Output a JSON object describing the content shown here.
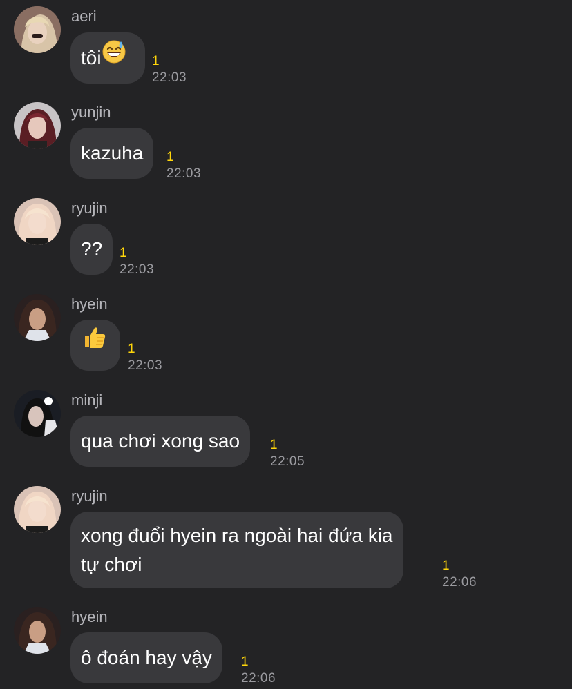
{
  "messages": [
    {
      "sender": "aeri",
      "text": "tôi",
      "emoji": "grinning-sweat-emoji",
      "unread": "1",
      "time": "22:03"
    },
    {
      "sender": "yunjin",
      "text": "kazuha",
      "unread": "1",
      "time": "22:03"
    },
    {
      "sender": "ryujin",
      "text": "??",
      "unread": "1",
      "time": "22:03"
    },
    {
      "sender": "hyein",
      "text": "",
      "emoji": "thumbs-up-emoji",
      "unread": "1",
      "time": "22:03"
    },
    {
      "sender": "minji",
      "text": "qua chơi xong sao",
      "unread": "1",
      "time": "22:05"
    },
    {
      "sender": "ryujin",
      "text_line1": "xong đuổi hyein ra ngoài hai đứa kia",
      "text_line2": "tự chơi",
      "unread": "1",
      "time": "22:06"
    },
    {
      "sender": "hyein",
      "text": "ô đoán hay vậy",
      "unread": "1",
      "time": "22:06"
    }
  ],
  "colors": {
    "background": "#232325",
    "bubble": "#39393c",
    "unread": "#ffd60a",
    "time": "#9a9a9f",
    "sender": "#b4b4b9"
  }
}
